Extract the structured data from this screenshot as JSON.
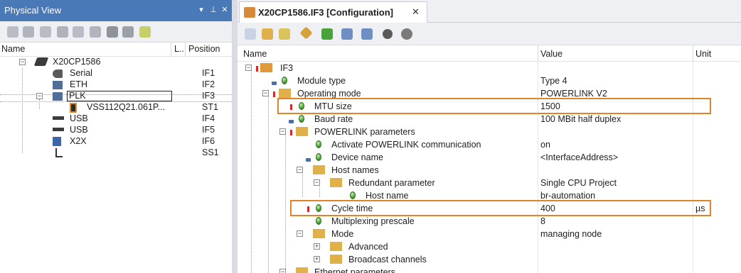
{
  "physical_view": {
    "title": "Physical View",
    "controls": [
      "▾",
      "⊥",
      "✕"
    ],
    "columns": {
      "name": "Name",
      "l": "L..",
      "position": "Position"
    },
    "items": [
      {
        "label": "X20CP1586",
        "position": ""
      },
      {
        "label": "Serial",
        "position": "IF1"
      },
      {
        "label": "ETH",
        "position": "IF2"
      },
      {
        "label": "PLK",
        "position": "IF3"
      },
      {
        "label": "VSS112Q21.061P...",
        "position": "ST1"
      },
      {
        "label": "USB",
        "position": "IF4"
      },
      {
        "label": "USB",
        "position": "IF5"
      },
      {
        "label": "X2X",
        "position": "IF6"
      },
      {
        "label": "",
        "position": "SS1"
      }
    ]
  },
  "document_tab": {
    "title": "X20CP1586.IF3 [Configuration]",
    "close": "✕"
  },
  "config_table": {
    "columns": {
      "name": "Name",
      "value": "Value",
      "unit": "Unit"
    },
    "rows": [
      {
        "name": "IF3",
        "value": "",
        "unit": ""
      },
      {
        "name": "Module type",
        "value": "Type 4",
        "unit": ""
      },
      {
        "name": "Operating mode",
        "value": "POWERLINK V2",
        "unit": ""
      },
      {
        "name": "MTU size",
        "value": "1500",
        "unit": ""
      },
      {
        "name": "Baud rate",
        "value": "100 MBit half duplex",
        "unit": ""
      },
      {
        "name": "POWERLINK parameters",
        "value": "",
        "unit": ""
      },
      {
        "name": "Activate POWERLINK communication",
        "value": "on",
        "unit": ""
      },
      {
        "name": "Device name",
        "value": "<InterfaceAddress>",
        "unit": ""
      },
      {
        "name": "Host names",
        "value": "",
        "unit": ""
      },
      {
        "name": "Redundant parameter",
        "value": "Single CPU Project",
        "unit": ""
      },
      {
        "name": "Host name",
        "value": "br-automation",
        "unit": ""
      },
      {
        "name": "Cycle time",
        "value": "400",
        "unit": "µs"
      },
      {
        "name": "Multiplexing prescale",
        "value": "8",
        "unit": ""
      },
      {
        "name": "Mode",
        "value": "managing node",
        "unit": ""
      },
      {
        "name": "Advanced",
        "value": "",
        "unit": ""
      },
      {
        "name": "Broadcast channels",
        "value": "",
        "unit": ""
      },
      {
        "name": "Ethernet parameters",
        "value": "",
        "unit": ""
      }
    ]
  },
  "colors": {
    "header_blue": "#4a79b8",
    "highlight_orange": "#e0842a",
    "selection_border": "#1e1e1e"
  }
}
